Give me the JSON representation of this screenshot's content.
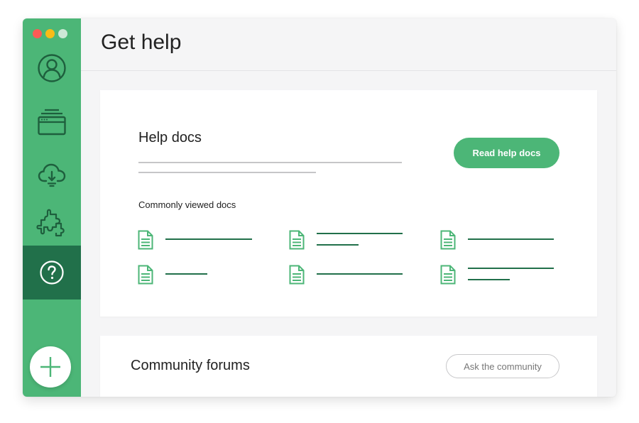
{
  "window": {
    "traffic_lights": [
      "red",
      "yellow",
      "green"
    ]
  },
  "sidebar": {
    "items": [
      {
        "name": "profile",
        "icon": "user-circle-icon",
        "active": false
      },
      {
        "name": "apps",
        "icon": "browser-stack-icon",
        "active": false
      },
      {
        "name": "cloud",
        "icon": "cloud-download-icon",
        "active": false
      },
      {
        "name": "extensions",
        "icon": "puzzle-icon",
        "active": false
      },
      {
        "name": "help",
        "icon": "question-circle-icon",
        "active": true
      }
    ],
    "add_button_icon": "plus-icon"
  },
  "header": {
    "title": "Get help"
  },
  "help_docs": {
    "title": "Help docs",
    "button_label": "Read help docs",
    "commonly_viewed_label": "Commonly viewed docs",
    "doc_icon": "document-icon"
  },
  "community": {
    "title": "Community forums",
    "button_label": "Ask the community"
  },
  "colors": {
    "sidebar_green": "#4cb677",
    "sidebar_active": "#21704a",
    "accent_green": "#4cb677",
    "placeholder_line_green": "#21704a",
    "placeholder_line_gray": "#c6c6c8"
  }
}
